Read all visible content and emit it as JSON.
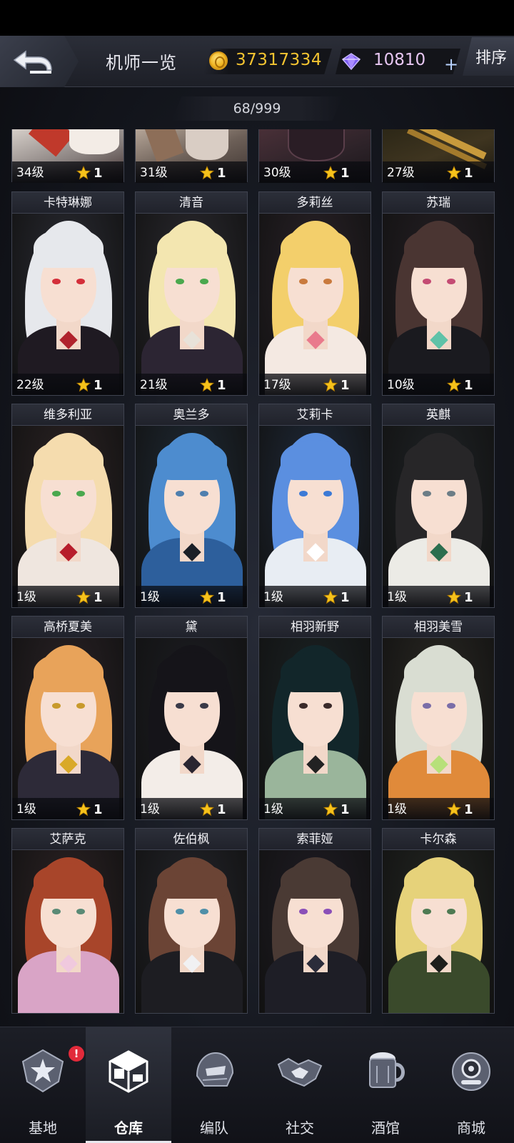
{
  "header": {
    "title": "机师一览",
    "gold": "37317334",
    "gems": "10810",
    "plus_label": "+",
    "sort_label": "排序",
    "back_icon": "back-arrow-icon",
    "coin_icon": "gold-coin-icon",
    "gem_icon": "diamond-icon"
  },
  "roster_count": "68/999",
  "top_row": [
    {
      "level": "34级",
      "stars": "1"
    },
    {
      "level": "31级",
      "stars": "1"
    },
    {
      "level": "30级",
      "stars": "1"
    },
    {
      "level": "27级",
      "stars": "1"
    }
  ],
  "pilots": [
    {
      "name": "卡特琳娜",
      "level": "22级",
      "stars": "1"
    },
    {
      "name": "清音",
      "level": "21级",
      "stars": "1"
    },
    {
      "name": "多莉丝",
      "level": "17级",
      "stars": "1"
    },
    {
      "name": "苏瑞",
      "level": "10级",
      "stars": "1"
    },
    {
      "name": "维多利亚",
      "level": "1级",
      "stars": "1"
    },
    {
      "name": "奥兰多",
      "level": "1级",
      "stars": "1"
    },
    {
      "name": "艾莉卡",
      "level": "1级",
      "stars": "1"
    },
    {
      "name": "英麒",
      "level": "1级",
      "stars": "1"
    },
    {
      "name": "高桥夏美",
      "level": "1级",
      "stars": "1"
    },
    {
      "name": "黛",
      "level": "1级",
      "stars": "1"
    },
    {
      "name": "相羽新野",
      "level": "1级",
      "stars": "1"
    },
    {
      "name": "相羽美雪",
      "level": "1级",
      "stars": "1"
    },
    {
      "name": "艾萨克",
      "level": "",
      "stars": ""
    },
    {
      "name": "佐伯枫",
      "level": "",
      "stars": ""
    },
    {
      "name": "索菲娅",
      "level": "",
      "stars": ""
    },
    {
      "name": "卡尔森",
      "level": "",
      "stars": ""
    }
  ],
  "nav": {
    "items": [
      {
        "label": "基地",
        "icon": "base-star-icon"
      },
      {
        "label": "仓库",
        "icon": "warehouse-cube-icon"
      },
      {
        "label": "编队",
        "icon": "formation-helmet-icon"
      },
      {
        "label": "社交",
        "icon": "handshake-icon"
      },
      {
        "label": "酒馆",
        "icon": "tavern-mug-icon"
      },
      {
        "label": "商城",
        "icon": "shop-robot-icon"
      }
    ],
    "active": "仓库",
    "badge": "!"
  },
  "colors": {
    "gold": "#f4c431",
    "gem": "#e7c6f2",
    "star": "#f6c21b",
    "badge": "#e22a3a"
  }
}
